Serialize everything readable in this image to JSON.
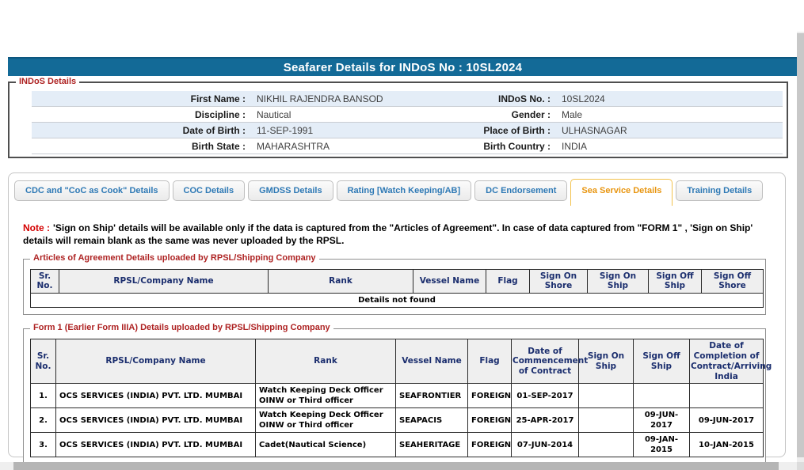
{
  "title": "Seafarer Details for INDoS No : 10SL2024",
  "indos_details": {
    "legend": "INDoS Details",
    "rows": [
      {
        "l1": "First Name :",
        "v1": "NIKHIL RAJENDRA BANSOD",
        "l2": "INDoS No. :",
        "v2": "10SL2024"
      },
      {
        "l1": "Discipline :",
        "v1": "Nautical",
        "l2": "Gender :",
        "v2": "Male"
      },
      {
        "l1": "Date of Birth :",
        "v1": "11-SEP-1991",
        "l2": "Place of Birth :",
        "v2": "ULHASNAGAR"
      },
      {
        "l1": "Birth State :",
        "v1": "MAHARASHTRA",
        "l2": "Birth Country :",
        "v2": "INDIA"
      }
    ]
  },
  "tabs": {
    "items": [
      "CDC and \"CoC as Cook\" Details",
      "COC Details",
      "GMDSS Details",
      "Rating [Watch Keeping/AB]",
      "DC Endorsement",
      "Sea Service Details",
      "Training Details"
    ],
    "active_index": 5
  },
  "note": {
    "label": "Note :",
    "text": "'Sign on Ship' details will be available only if the data is captured from the \"Articles of Agreement\". In case of data captured from \"FORM 1\" , 'Sign on Ship' details will remain blank as the same was never uploaded by the RPSL."
  },
  "agreement_table": {
    "legend": "Articles of Agreement Details uploaded by RPSL/Shipping Company",
    "headers": [
      "Sr. No.",
      "RPSL/Company Name",
      "Rank",
      "Vessel Name",
      "Flag",
      "Sign On Shore",
      "Sign On Ship",
      "Sign Off Ship",
      "Sign Off Shore"
    ],
    "empty_message": "Details not found"
  },
  "form1_table": {
    "legend": "Form 1 (Earlier Form IIIA) Details uploaded by RPSL/Shipping Company",
    "headers": [
      "Sr. No.",
      "RPSL/Company Name",
      "Rank",
      "Vessel Name",
      "Flag",
      "Date of Commencement of Contract",
      "Sign On Ship",
      "Sign Off Ship",
      "Date of Completion of Contract/Arriving India"
    ],
    "rows": [
      [
        "1.",
        "OCS SERVICES (INDIA) PVT. LTD. MUMBAI",
        "Watch Keeping Deck Officer OINW or Third officer",
        "SEAFRONTIER",
        "FOREIGN",
        "01-SEP-2017",
        "",
        "",
        ""
      ],
      [
        "2.",
        "OCS SERVICES (INDIA) PVT. LTD. MUMBAI",
        "Watch Keeping Deck Officer OINW or Third officer",
        "SEAPACIS",
        "FOREIGN",
        "25-APR-2017",
        "",
        "09-JUN-2017",
        "09-JUN-2017"
      ],
      [
        "3.",
        "OCS SERVICES (INDIA) PVT. LTD. MUMBAI",
        "Cadet(Nautical Science)",
        "SEAHERITAGE",
        "FOREIGN",
        "07-JUN-2014",
        "",
        "09-JAN-2015",
        "10-JAN-2015"
      ]
    ]
  },
  "colors": {
    "title_bar": "#136A97",
    "row_highlight": "#E4EDF7",
    "legend_red": "#AE2323",
    "note_red": "#D40000",
    "tab_text": "#2E79B5",
    "tab_active_text": "#E8950F",
    "tab_active_border": "#F2C24E",
    "header_navy": "#1B2E6E",
    "error_red": "#E00000"
  }
}
